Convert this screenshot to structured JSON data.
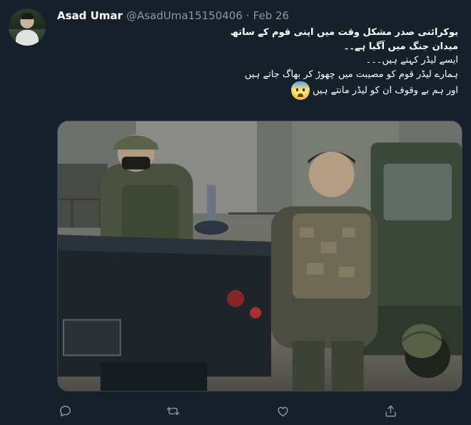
{
  "tweet": {
    "author_name": "Asad Umar",
    "author_handle": "@AsadUma15150406",
    "separator": "·",
    "date": "Feb 26",
    "text_lines": [
      "یوکرائنی صدر مشکل وقت میں اپنی قوم کے ساتھ",
      "میدان جنگ میں آگیا ہے۔۔",
      "ایسے لیڈر کہتے ہیں۔۔۔",
      "ہمارے لیڈر قوم کو مصیبت میں چھوڑ کر بھاگ جاتے ہیں",
      "اور ہم بے وقوف ان کو لیڈر مانتے ہیں"
    ],
    "emoji": "anxious-face-with-sweat"
  },
  "actions": {
    "icons": [
      "reply-icon",
      "retweet-icon",
      "like-icon",
      "share-icon"
    ]
  },
  "colors": {
    "background": "#15202b",
    "secondary_text": "#8899a6",
    "icon": "#8899a6",
    "border": "#38444d"
  }
}
